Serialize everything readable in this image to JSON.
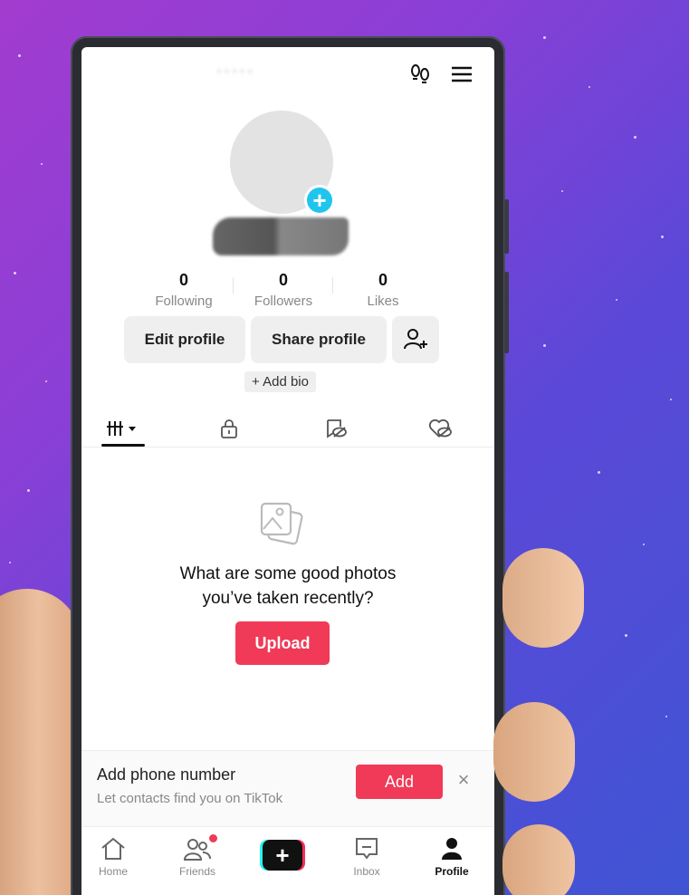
{
  "header": {
    "username": "· · · · ·",
    "footprints_icon": "footprints-icon",
    "menu_icon": "hamburger-menu-icon"
  },
  "profile": {
    "display_name": "",
    "stats": [
      {
        "value": "0",
        "label": "Following"
      },
      {
        "value": "0",
        "label": "Followers"
      },
      {
        "value": "0",
        "label": "Likes"
      }
    ],
    "edit_profile_label": "Edit profile",
    "share_profile_label": "Share profile",
    "add_bio_label": "+ Add bio"
  },
  "tabs": [
    {
      "icon": "grid-icon",
      "active": true
    },
    {
      "icon": "lock-icon",
      "active": false
    },
    {
      "icon": "reposts-icon",
      "active": false
    },
    {
      "icon": "liked-icon",
      "active": false
    }
  ],
  "empty_state": {
    "line1": "What are some good photos",
    "line2": "you’ve taken recently?",
    "upload_label": "Upload"
  },
  "phone_banner": {
    "title": "Add phone number",
    "subtitle": "Let contacts find you on TikTok",
    "add_label": "Add",
    "close_glyph": "×"
  },
  "navbar": {
    "items": [
      {
        "label": "Home",
        "icon": "home-icon"
      },
      {
        "label": "Friends",
        "icon": "friends-icon"
      },
      {
        "label": "",
        "icon": "create-icon"
      },
      {
        "label": "Inbox",
        "icon": "inbox-icon"
      },
      {
        "label": "Profile",
        "icon": "profile-icon"
      }
    ]
  },
  "colors": {
    "accent": "#f03a57",
    "avatar_plus": "#20c5ee"
  }
}
